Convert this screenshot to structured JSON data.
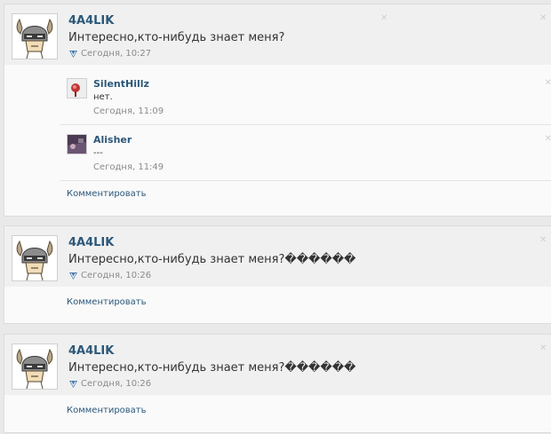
{
  "posts": [
    {
      "author": "4A4LIK",
      "text": "Интересно,кто-нибудь знает меня?",
      "date": "Сегодня, 10:27",
      "comments": [
        {
          "author": "SilentHillz",
          "text": "нет.",
          "date": "Сегодня, 11:09"
        },
        {
          "author": "Alisher",
          "text": "---",
          "date": "Сегодня, 11:49"
        }
      ],
      "comment_link": "Комментировать"
    },
    {
      "author": "4A4LIK",
      "text": "Интересно,кто-нибудь знает меня?������",
      "date": "Сегодня, 10:26",
      "comment_link": "Комментировать"
    },
    {
      "author": "4A4LIK",
      "text": "Интересно,кто-нибудь знает меня?������",
      "date": "Сегодня, 10:26",
      "comment_link": "Комментировать"
    }
  ],
  "icons": {
    "delete": "close-icon",
    "source": "vk-check-icon",
    "avatar": "dragonborn-helmet-avatar"
  },
  "colors": {
    "link": "#2b587a",
    "meta": "#8a8a8a",
    "background": "#e9e9e9",
    "card": "#fafafa"
  }
}
